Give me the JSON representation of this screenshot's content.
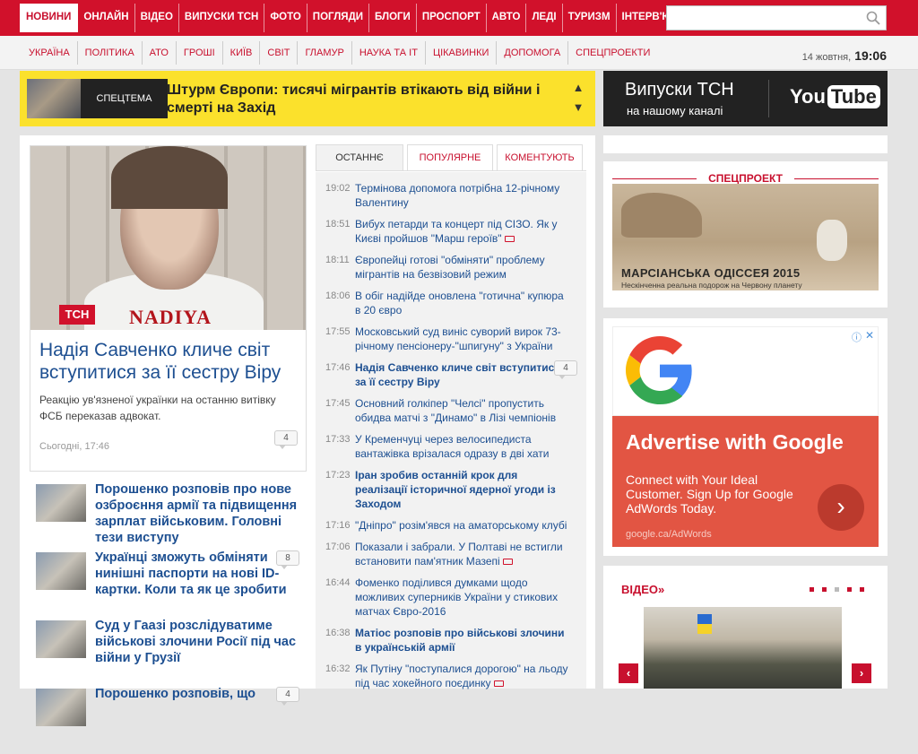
{
  "topnav": {
    "items": [
      "Новини",
      "Онлайн",
      "Відео",
      "Випуски ТСН",
      "Фото",
      "Погляди",
      "Блоги",
      "Проспорт",
      "Авто",
      "Леді",
      "Туризм",
      "Інтерв'ю"
    ],
    "active_index": 0
  },
  "search": {
    "placeholder": "",
    "icon": "search-icon"
  },
  "subnav": {
    "items": [
      "Україна",
      "Політика",
      "АТО",
      "Гроші",
      "Київ",
      "Світ",
      "Гламур",
      "Наука та ІТ",
      "Цікавинки",
      "Допомога",
      "Спецпроекти"
    ]
  },
  "datetime": {
    "date": "14 жовтня,",
    "time": "19:06"
  },
  "special_theme": {
    "label": "Спецтема",
    "headline": "Штурм Європи: тисячі мігрантів втікають від війни і смерті на Захід"
  },
  "youtube_banner": {
    "line1": "Випуски ТСН",
    "line2": "на нашому каналі",
    "logo_you": "You",
    "logo_tube": "Tube"
  },
  "lead_story": {
    "image_text": "NADIYA",
    "image_badge": "ТСН",
    "title": "Надія Савченко кличе світ вступитися за її сестру Віру",
    "description": "Реакцію ув'язненої українки на останню витівку ФСБ переказав адвокат.",
    "date": "Сьогодні, 17:46",
    "comments": "4"
  },
  "news_list": [
    {
      "title": "Порошенко розповів про нове озброєння армії та підвищення зарплат військовим. Головні тези виступу",
      "comments": ""
    },
    {
      "title": "Українці зможуть обміняти нинішні паспорти на нові ID-картки. Коли та як це зробити",
      "comments": "8"
    },
    {
      "title": "Суд у Гаазі розслідуватиме військові злочини Росії під час війни у Грузії",
      "comments": ""
    },
    {
      "title": "Порошенко розповів, що",
      "comments": "4"
    }
  ],
  "feed_tabs": [
    "Останнє",
    "Популярне",
    "Коментують"
  ],
  "feed": [
    {
      "time": "19:02",
      "text": "Термінова допомога потрібна 12-річному Валентину",
      "bold": false,
      "comments": "",
      "media": false
    },
    {
      "time": "18:51",
      "text": "Вибух петарди та концерт під СІЗО. Як у Києві пройшов \"Марш героїв\"",
      "bold": false,
      "comments": "",
      "media": true
    },
    {
      "time": "18:11",
      "text": "Європейці готові \"обміняти\" проблему мігрантів на безвізовий режим",
      "bold": false,
      "comments": "",
      "media": false
    },
    {
      "time": "18:06",
      "text": "В обіг надійде оновлена \"готична\" купюра в 20 євро",
      "bold": false,
      "comments": "",
      "media": false
    },
    {
      "time": "17:55",
      "text": "Московський суд виніс суворий вирок 73-річному пенсіонеру-\"шпигуну\" з України",
      "bold": false,
      "comments": "",
      "media": false
    },
    {
      "time": "17:46",
      "text": "Надія Савченко кличе світ вступитися за її сестру Віру",
      "bold": true,
      "comments": "4",
      "media": false
    },
    {
      "time": "17:45",
      "text": "Основний голкіпер \"Челсі\" пропустить обидва матчі з \"Динамо\" в Лізі чемпіонів",
      "bold": false,
      "comments": "",
      "media": false
    },
    {
      "time": "17:33",
      "text": "У Кременчуці через велосипедиста вантажівка врізалася одразу в дві хати",
      "bold": false,
      "comments": "",
      "media": false
    },
    {
      "time": "17:23",
      "text": "Іран зробив останній крок для реалізації історичної ядерної угоди із Заходом",
      "bold": true,
      "comments": "",
      "media": false
    },
    {
      "time": "17:16",
      "text": "\"Дніпро\" розім'явся на аматорському клубі",
      "bold": false,
      "comments": "",
      "media": false
    },
    {
      "time": "17:06",
      "text": "Показали і забрали. У Полтаві не встигли встановити пам'ятник Мазепі",
      "bold": false,
      "comments": "",
      "media": true
    },
    {
      "time": "16:44",
      "text": "Фоменко поділився думками щодо можливих суперників України у стикових матчах Євро-2016",
      "bold": false,
      "comments": "",
      "media": false
    },
    {
      "time": "16:38",
      "text": "Матіос розповів про військові злочини в українській армії",
      "bold": true,
      "comments": "",
      "media": false
    },
    {
      "time": "16:32",
      "text": "Як Путіну \"поступалися дорогою\" на льоду під час хокейного поєдинку",
      "bold": false,
      "comments": "",
      "media": true
    }
  ],
  "special_project": {
    "header": "Спецпроект",
    "title": "МАРСІАНСЬКА ОДІССЕЯ 2015",
    "subtitle": "Нескінченна реальна подорож на Червону планету"
  },
  "ad": {
    "headline": "Advertise with Google",
    "body": "Connect with Your Ideal Customer. Sign Up for Google AdWords Today.",
    "url": "google.ca/AdWords",
    "info": "ⓘ",
    "close": "✕"
  },
  "video_block": {
    "header": "Відео",
    "header_arrows": "»",
    "prev": "‹",
    "next": "›"
  },
  "colors": {
    "brand_red": "#d1112b",
    "link_blue": "#1d4f91",
    "banner_yellow": "#fbe12c"
  }
}
